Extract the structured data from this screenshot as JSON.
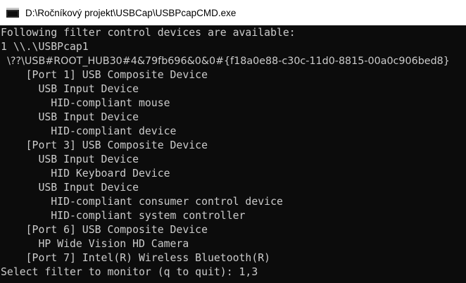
{
  "window": {
    "title": "D:\\Ročníkový projekt\\USBCap\\USBPcapCMD.exe",
    "icon": "console-app-icon"
  },
  "colors": {
    "background": "#0c0c0c",
    "text": "#cccccc",
    "titlebar": "#ffffff"
  },
  "console": {
    "lines": [
      "Following filter control devices are available:",
      "1 \\\\.\\USBPcap1",
      "  \\??\\USB#ROOT_HUB30#4&79fb696&0&0#{f18a0e88-c30c-11d0-8815-00a0c906bed8}",
      "    [Port 1] USB Composite Device",
      "      USB Input Device",
      "        HID-compliant mouse",
      "      USB Input Device",
      "        HID-compliant device",
      "    [Port 3] USB Composite Device",
      "      USB Input Device",
      "        HID Keyboard Device",
      "      USB Input Device",
      "        HID-compliant consumer control device",
      "        HID-compliant system controller",
      "    [Port 6] USB Composite Device",
      "      HP Wide Vision HD Camera",
      "    [Port 7] Intel(R) Wireless Bluetooth(R)",
      "Select filter to monitor (q to quit): 1,3"
    ]
  }
}
